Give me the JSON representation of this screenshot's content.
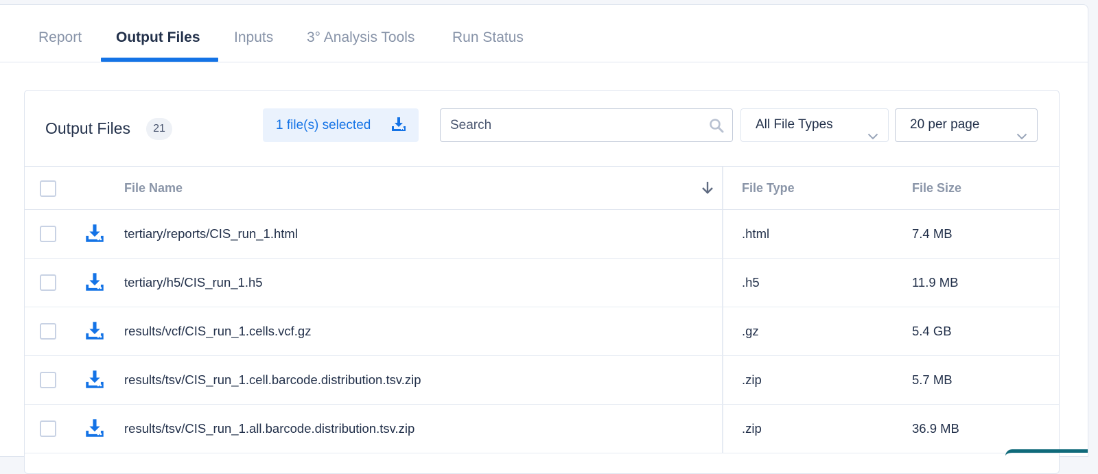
{
  "tabs": [
    {
      "label": "Report",
      "active": false
    },
    {
      "label": "Output Files",
      "active": true
    },
    {
      "label": "Inputs",
      "active": false
    },
    {
      "label": "3° Analysis Tools",
      "active": false
    },
    {
      "label": "Run Status",
      "active": false
    }
  ],
  "output": {
    "title": "Output Files",
    "count": "21",
    "selected_label": "1 file(s) selected",
    "search_placeholder": "Search",
    "file_type_filter": "All File Types",
    "per_page": "20 per page"
  },
  "table": {
    "headers": {
      "name": "File Name",
      "type": "File Type",
      "size": "File Size"
    },
    "rows": [
      {
        "name": "tertiary/reports/CIS_run_1.html",
        "type": ".html",
        "size": "7.4 MB"
      },
      {
        "name": "tertiary/h5/CIS_run_1.h5",
        "type": ".h5",
        "size": "11.9 MB"
      },
      {
        "name": "results/vcf/CIS_run_1.cells.vcf.gz",
        "type": ".gz",
        "size": "5.4 GB"
      },
      {
        "name": "results/tsv/CIS_run_1.cell.barcode.distribution.tsv.zip",
        "type": ".zip",
        "size": "5.7 MB"
      },
      {
        "name": "results/tsv/CIS_run_1.all.barcode.distribution.tsv.zip",
        "type": ".zip",
        "size": "36.9 MB"
      }
    ]
  },
  "colors": {
    "accent": "#1473e6",
    "text": "#22304a",
    "muted": "#8793a8"
  },
  "icons": {
    "download": "download-icon",
    "search": "search-icon",
    "chevron": "chevron-down-icon",
    "sort": "arrow-down-icon"
  }
}
